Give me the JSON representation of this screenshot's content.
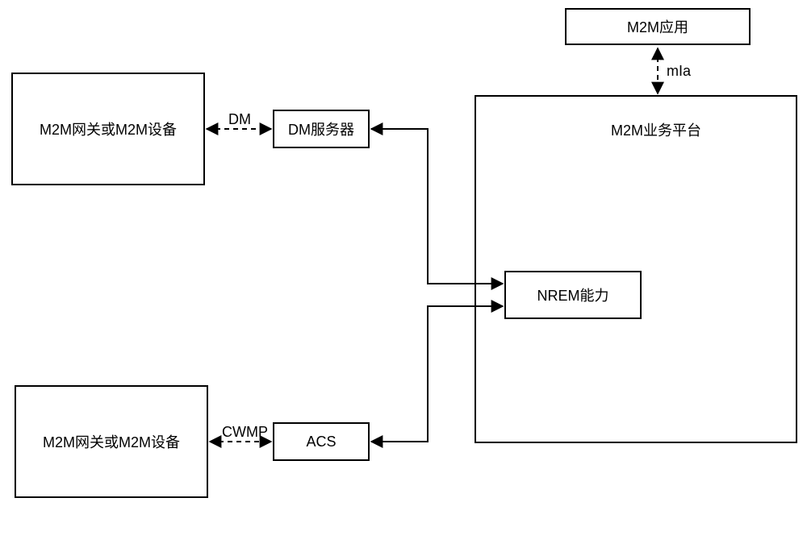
{
  "boxes": {
    "m2m_app": "M2M应用",
    "gateway_top": "M2M网关或M2M设备",
    "gateway_bottom": "M2M网关或M2M设备",
    "dm_server": "DM服务器",
    "acs": "ACS",
    "platform": "M2M业务平台",
    "nrem": "NREM能力"
  },
  "labels": {
    "dm": "DM",
    "cwmp": "CWMP",
    "mia": "mIa"
  }
}
